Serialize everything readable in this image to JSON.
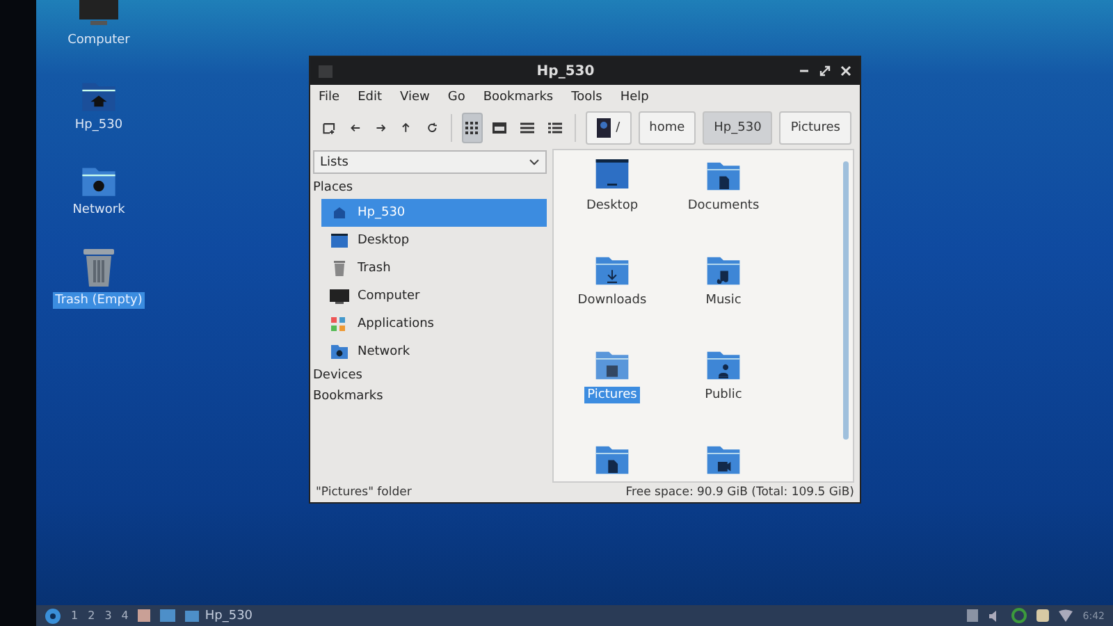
{
  "desktop_icons": [
    {
      "label": "Computer",
      "kind": "computer",
      "selected": false
    },
    {
      "label": "Hp_530",
      "kind": "home",
      "selected": false
    },
    {
      "label": "Network",
      "kind": "network",
      "selected": false
    },
    {
      "label": "Trash (Empty)",
      "kind": "trash",
      "selected": true
    }
  ],
  "window": {
    "title": "Hp_530"
  },
  "menu": [
    "File",
    "Edit",
    "View",
    "Go",
    "Bookmarks",
    "Tools",
    "Help"
  ],
  "view_modes": [
    {
      "kind": "icons",
      "selected": true
    },
    {
      "kind": "thumbnails",
      "selected": false
    },
    {
      "kind": "compact",
      "selected": false
    },
    {
      "kind": "details",
      "selected": false
    }
  ],
  "path_bar": [
    {
      "label": "/",
      "kind": "root",
      "selected": false
    },
    {
      "label": "home",
      "kind": "dir",
      "selected": false
    },
    {
      "label": "Hp_530",
      "kind": "dir",
      "selected": true
    },
    {
      "label": "Pictures",
      "kind": "dir",
      "selected": false
    }
  ],
  "side_pane": {
    "mode": "Lists",
    "sections": [
      {
        "title": "Places",
        "items": [
          {
            "label": "Hp_530",
            "kind": "home",
            "selected": true
          },
          {
            "label": "Desktop",
            "kind": "desktop",
            "selected": false
          },
          {
            "label": "Trash",
            "kind": "trash",
            "selected": false
          },
          {
            "label": "Computer",
            "kind": "computer",
            "selected": false
          },
          {
            "label": "Applications",
            "kind": "apps",
            "selected": false
          },
          {
            "label": "Network",
            "kind": "network",
            "selected": false
          }
        ]
      },
      {
        "title": "Devices"
      },
      {
        "title": "Bookmarks"
      }
    ]
  },
  "files": [
    {
      "name": "Desktop",
      "kind": "desktop",
      "selected": false
    },
    {
      "name": "Documents",
      "kind": "documents",
      "selected": false
    },
    {
      "name": "Downloads",
      "kind": "downloads",
      "selected": false
    },
    {
      "name": "Music",
      "kind": "music",
      "selected": false
    },
    {
      "name": "Pictures",
      "kind": "pictures",
      "selected": true
    },
    {
      "name": "Public",
      "kind": "public",
      "selected": false
    },
    {
      "kind": "templates",
      "selected": false
    },
    {
      "kind": "videos",
      "selected": false
    }
  ],
  "status_bar": {
    "selection": "\"Pictures\" folder",
    "free_space": "Free space: 90.9 GiB (Total: 109.5 GiB)"
  },
  "taskbar": {
    "workspaces": [
      "1",
      "2",
      "3",
      "4"
    ],
    "tasks": [
      {
        "label": "Hp_530"
      }
    ],
    "clock": "6:42"
  }
}
